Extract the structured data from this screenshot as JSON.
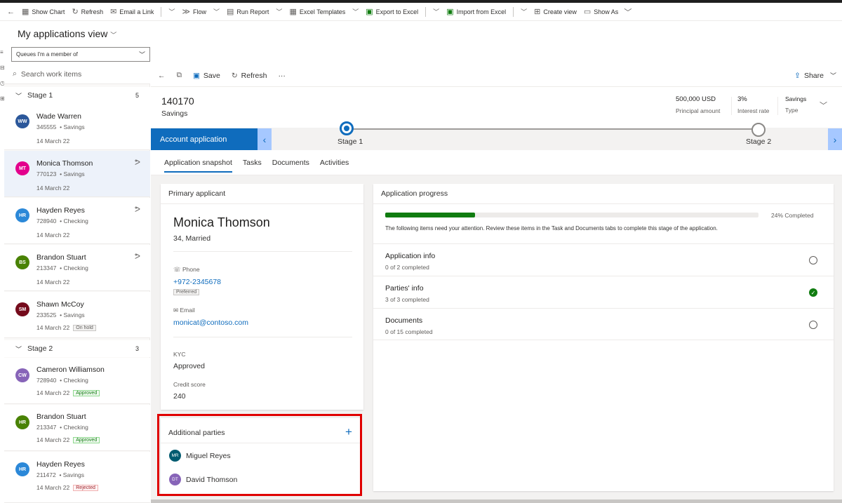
{
  "commandbar": {
    "items": [
      {
        "label": "Show Chart",
        "icon": "chart-icon"
      },
      {
        "label": "Refresh",
        "icon": "refresh-icon"
      },
      {
        "label": "Email a Link",
        "icon": "email-link-icon"
      },
      {
        "label": "Flow",
        "icon": "flow-icon"
      },
      {
        "label": "Run Report",
        "icon": "report-icon"
      },
      {
        "label": "Excel Templates",
        "icon": "excel-templates-icon"
      },
      {
        "label": "Export to Excel",
        "icon": "excel-icon"
      },
      {
        "label": "Import from Excel",
        "icon": "excel-import-icon"
      },
      {
        "label": "Create view",
        "icon": "create-view-icon"
      },
      {
        "label": "Show As",
        "icon": "show-as-icon"
      }
    ]
  },
  "view": {
    "title": "My applications view",
    "queue_filter": "Queues I'm a member of"
  },
  "search": {
    "placeholder": "Search work items"
  },
  "stages": [
    {
      "label": "Stage 1",
      "count": "5"
    },
    {
      "label": "Stage 2",
      "count": "3"
    }
  ],
  "worklist": [
    {
      "initials": "WW",
      "name": "Wade Warren",
      "id": "345555",
      "type": "Savings",
      "date": "14 March 22",
      "badge": "",
      "color": "#2b579a"
    },
    {
      "initials": "MT",
      "name": "Monica Thomson",
      "id": "770123",
      "type": "Savings",
      "date": "14 March 22",
      "badge": "",
      "color": "#e3008c"
    },
    {
      "initials": "HR",
      "name": "Hayden Reyes",
      "id": "728940",
      "type": "Checking",
      "date": "14 March 22",
      "badge": "",
      "color": "#2b88d8"
    },
    {
      "initials": "BS",
      "name": "Brandon Stuart",
      "id": "213347",
      "type": "Checking",
      "date": "14 March 22",
      "badge": "",
      "color": "#498205"
    },
    {
      "initials": "SM",
      "name": "Shawn McCoy",
      "id": "233525",
      "type": "Savings",
      "date": "14 March 22",
      "badge": "On hold",
      "color": "#750b1c"
    },
    {
      "initials": "CW",
      "name": "Cameron Williamson",
      "id": "728940",
      "type": "Checking",
      "date": "14 March 22",
      "badge": "Approved",
      "color": "#8764b8"
    },
    {
      "initials": "HR",
      "name": "Brandon Stuart",
      "id": "213347",
      "type": "Checking",
      "date": "14 March 22",
      "badge": "Approved",
      "color": "#498205"
    },
    {
      "initials": "HR",
      "name": "Hayden Reyes",
      "id": "211472",
      "type": "Savings",
      "date": "14 March 22",
      "badge": "Rejected",
      "color": "#2b88d8"
    }
  ],
  "record_toolbar": {
    "save": "Save",
    "refresh": "Refresh",
    "more": "···",
    "share": "Share"
  },
  "record": {
    "id": "140170",
    "type": "Savings",
    "principal_amount": "500,000 USD",
    "principal_label": "Principal amount",
    "interest_rate": "3%",
    "interest_label": "Interest rate",
    "product_type": "Savings",
    "product_type_label": "Type"
  },
  "process": {
    "active_stage_name": "Account application",
    "stage1": "Stage 1",
    "stage2": "Stage 2"
  },
  "tabs": [
    "Application snapshot",
    "Tasks",
    "Documents",
    "Activities"
  ],
  "primary": {
    "title": "Primary applicant",
    "name": "Monica Thomson",
    "details": "34, Married",
    "phone_label": "Phone",
    "phone": "+972-2345678",
    "phone_badge": "Preferred",
    "email_label": "Email",
    "email": "monicat@contoso.com",
    "kyc_label": "KYC",
    "kyc": "Approved",
    "credit_label": "Credit score",
    "credit": "240"
  },
  "additional": {
    "title": "Additional parties",
    "add": "+",
    "parties": [
      {
        "initials": "MR",
        "name": "Miguel Reyes",
        "color": "#005b70"
      },
      {
        "initials": "DT",
        "name": "David Thomson",
        "color": "#8764b8"
      }
    ]
  },
  "progress": {
    "title": "Application progress",
    "percent": 24,
    "percent_label": "24% Completed",
    "note": "The following items need your attention. Review these items in the Task and Documents tabs to complete this stage of the application.",
    "items": [
      {
        "title": "Application info",
        "sub": "0 of 2 completed",
        "done": false
      },
      {
        "title": "Parties' info",
        "sub": "3 of 3 completed",
        "done": true
      },
      {
        "title": "Documents",
        "sub": "0 of 15 completed",
        "done": false
      }
    ]
  }
}
